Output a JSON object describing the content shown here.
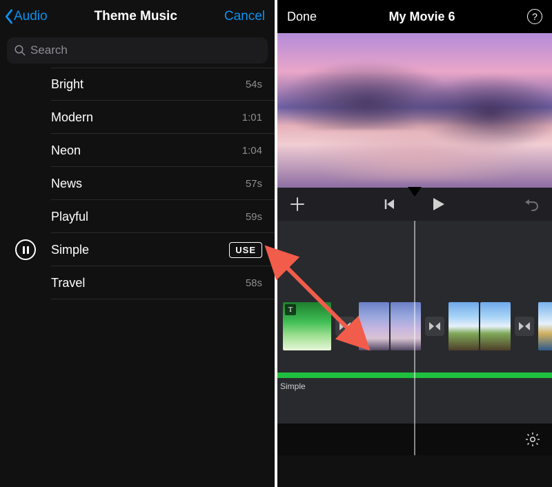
{
  "left": {
    "back_label": "Audio",
    "title": "Theme Music",
    "cancel_label": "Cancel",
    "search_placeholder": "Search",
    "use_label": "USE",
    "themes": [
      {
        "name": "Bright",
        "duration": "54s"
      },
      {
        "name": "Modern",
        "duration": "1:01"
      },
      {
        "name": "Neon",
        "duration": "1:04"
      },
      {
        "name": "News",
        "duration": "57s"
      },
      {
        "name": "Playful",
        "duration": "59s"
      },
      {
        "name": "Simple",
        "duration": ""
      },
      {
        "name": "Travel",
        "duration": "58s"
      }
    ],
    "playing_index": 5
  },
  "right": {
    "done_label": "Done",
    "title": "My Movie 6",
    "help_label": "?",
    "audio_track_label": "Simple",
    "title_badge": "T"
  },
  "colors": {
    "accent": "#0a92f2",
    "audio_green": "#1fbf3f"
  }
}
